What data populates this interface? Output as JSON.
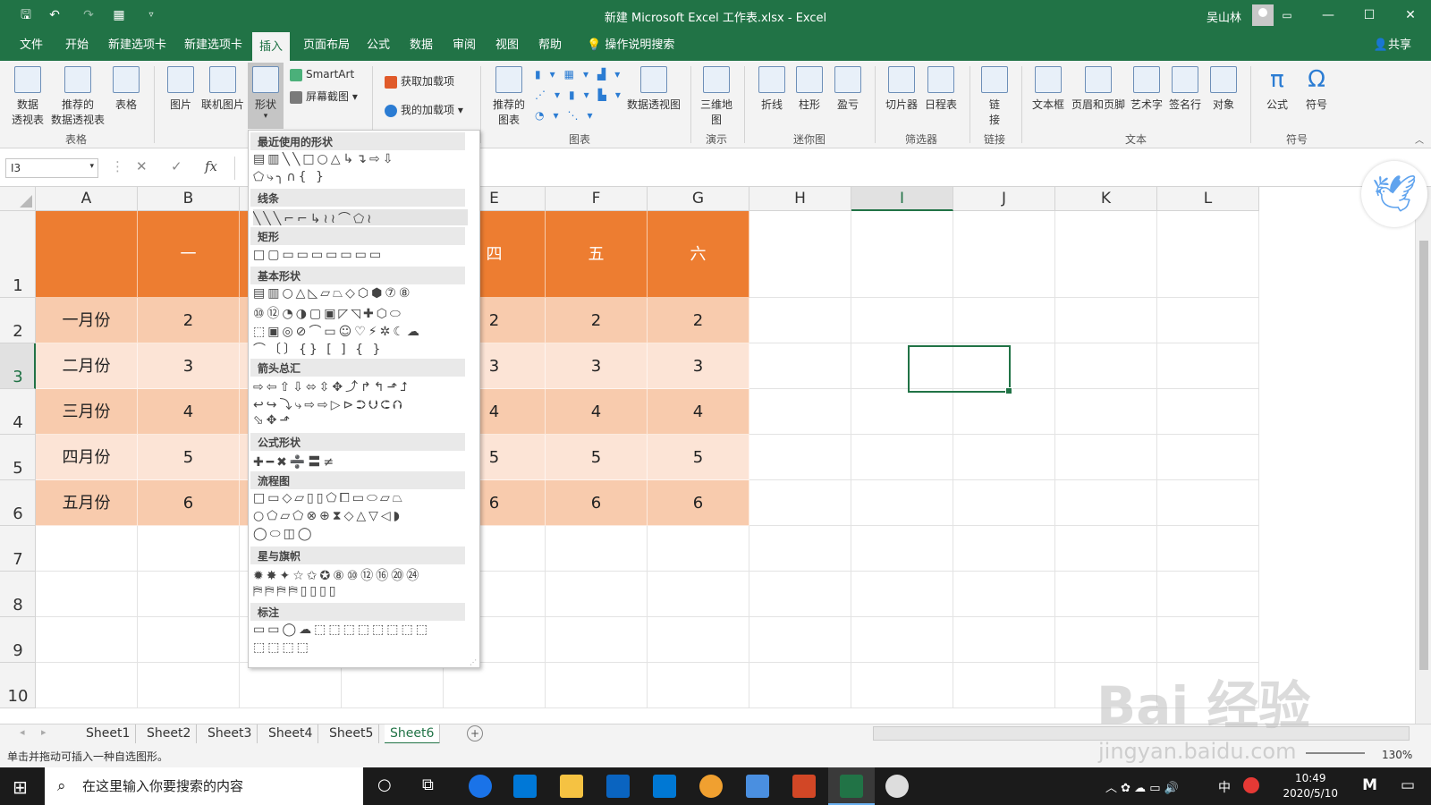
{
  "window": {
    "title": "新建 Microsoft Excel 工作表.xlsx  -  Excel",
    "user": "吴山林",
    "minimize": "—",
    "restore": "☐",
    "close": "✕"
  },
  "ribbon_tabs": [
    "文件",
    "开始",
    "新建选项卡",
    "新建选项卡",
    "插入",
    "页面布局",
    "公式",
    "数据",
    "审阅",
    "视图",
    "帮助",
    "操作说明搜索"
  ],
  "active_tab": "插入",
  "share": "共享",
  "ribbon": {
    "tables": {
      "pivot": "数据\n透视表",
      "recommended_pivot": "推荐的\n数据透视表",
      "table": "表格",
      "group": "表格"
    },
    "illustrations": {
      "picture": "图片",
      "online_picture": "联机图片",
      "shapes": "形状",
      "smartart": "SmartArt",
      "screenshot": "屏幕截图"
    },
    "addins": {
      "get": "获取加载项",
      "mine": "我的加载项"
    },
    "charts": {
      "recommended": "推荐的\n图表",
      "pivot_chart": "数据透视图",
      "group": "图表"
    },
    "tours": {
      "map3d": "三维地\n图",
      "group": "演示"
    },
    "sparklines": {
      "line": "折线",
      "column": "柱形",
      "winloss": "盈亏",
      "group": "迷你图"
    },
    "filters": {
      "slicer": "切片器",
      "timeline": "日程表",
      "group": "筛选器"
    },
    "links": {
      "link": "链\n接",
      "group": "链接"
    },
    "text": {
      "textbox": "文本框",
      "header_footer": "页眉和页脚",
      "wordart": "艺术字",
      "signature": "签名行",
      "object": "对象",
      "group": "文本"
    },
    "symbols": {
      "equation": "公式",
      "symbol": "符号",
      "group": "符号"
    }
  },
  "formula_bar": {
    "name_box": "I3",
    "fx": "fx",
    "cancel": "✕",
    "enter": "✓"
  },
  "columns": [
    "A",
    "B",
    "C",
    "D",
    "E",
    "F",
    "G",
    "H",
    "I",
    "J",
    "K",
    "L"
  ],
  "selected_column": "I",
  "rows": [
    "1",
    "2",
    "3",
    "4",
    "5",
    "6",
    "7",
    "8",
    "9",
    "10"
  ],
  "selected_row": "3",
  "table": {
    "header_visible": [
      "",
      "一",
      "",
      "",
      "四",
      "五",
      "六"
    ],
    "row_labels": [
      "一月份",
      "二月份",
      "三月份",
      "四月份",
      "五月份"
    ],
    "col_b": [
      "2",
      "3",
      "4",
      "5",
      "6"
    ],
    "col_e": [
      "2",
      "3",
      "4",
      "5",
      "6"
    ],
    "col_f": [
      "2",
      "3",
      "4",
      "5",
      "6"
    ],
    "col_g": [
      "2",
      "3",
      "4",
      "5",
      "6"
    ]
  },
  "colors": {
    "excel_green": "#217346",
    "header_orange": "#ed7d31",
    "band_dark": "#f8cbad",
    "band_light": "#fce4d6"
  },
  "shapes_menu": {
    "sections": [
      "最近使用的形状",
      "线条",
      "矩形",
      "基本形状",
      "箭头总汇",
      "公式形状",
      "流程图",
      "星与旗帜",
      "标注"
    ],
    "recent_row1": "▤▥╲╲□○△↳↴⇨⇩",
    "recent_row2": "⬠⤷╮∩{ }",
    "lines_row": "╲╲╲⌐⌐↳≀≀⌒⬠≀",
    "rect_row": "□▢▭▭▭▭▭▭▭",
    "basic_row1": "▤▥○△◺▱⏢◇⬡⬢⑦⑧",
    "basic_row2": "⑩⑫◔◑▢▣◸◹✚⬡⬭",
    "basic_row3": "⬚▣◎⊘⌒▭☺♡⚡✲☾☁",
    "basic_row4": "⌒〔〕{} [ ] { }",
    "arrows_row1": "⇨⇦⇧⇩⬄⇳✥⤴↱↰⬏⮥",
    "arrows_row2": "↩↪⤵⤷⇨⇨▷⊳⮊⮋⮈⮉",
    "arrows_row3": "⬂✥⬏",
    "eq_row": "✚━✖➗〓≠",
    "flow_row1": "□▭◇▱▯▯⬠⧠▭⬭▱⏢",
    "flow_row2": "○⬠⏥⬠⊗⊕⧗◇△▽◁◗",
    "flow_row3": "◯⬭◫◯",
    "stars_row1": "✹✸✦☆✩✪⑧⑩⑫⑯⑳㉔",
    "stars_row2": "⛿⛿⛿⛿▯▯▯▯",
    "callouts_row1": "▭▭◯☁⬚⬚⬚⬚⬚⬚⬚⬚",
    "callouts_row2": "⬚⬚⬚⬚"
  },
  "sheets": [
    "Sheet1",
    "Sheet2",
    "Sheet3",
    "Sheet4",
    "Sheet5",
    "Sheet6"
  ],
  "active_sheet": "Sheet6",
  "status": {
    "message": "单击并拖动可插入一种自选图形。",
    "zoom": "130%"
  },
  "taskbar": {
    "search_placeholder": "在这里输入你要搜索的内容",
    "time": "10:49",
    "date": "2020/5/10",
    "ime": "中"
  },
  "watermark": {
    "brand": "Bai 经验",
    "url": "jingyan.baidu.com"
  }
}
